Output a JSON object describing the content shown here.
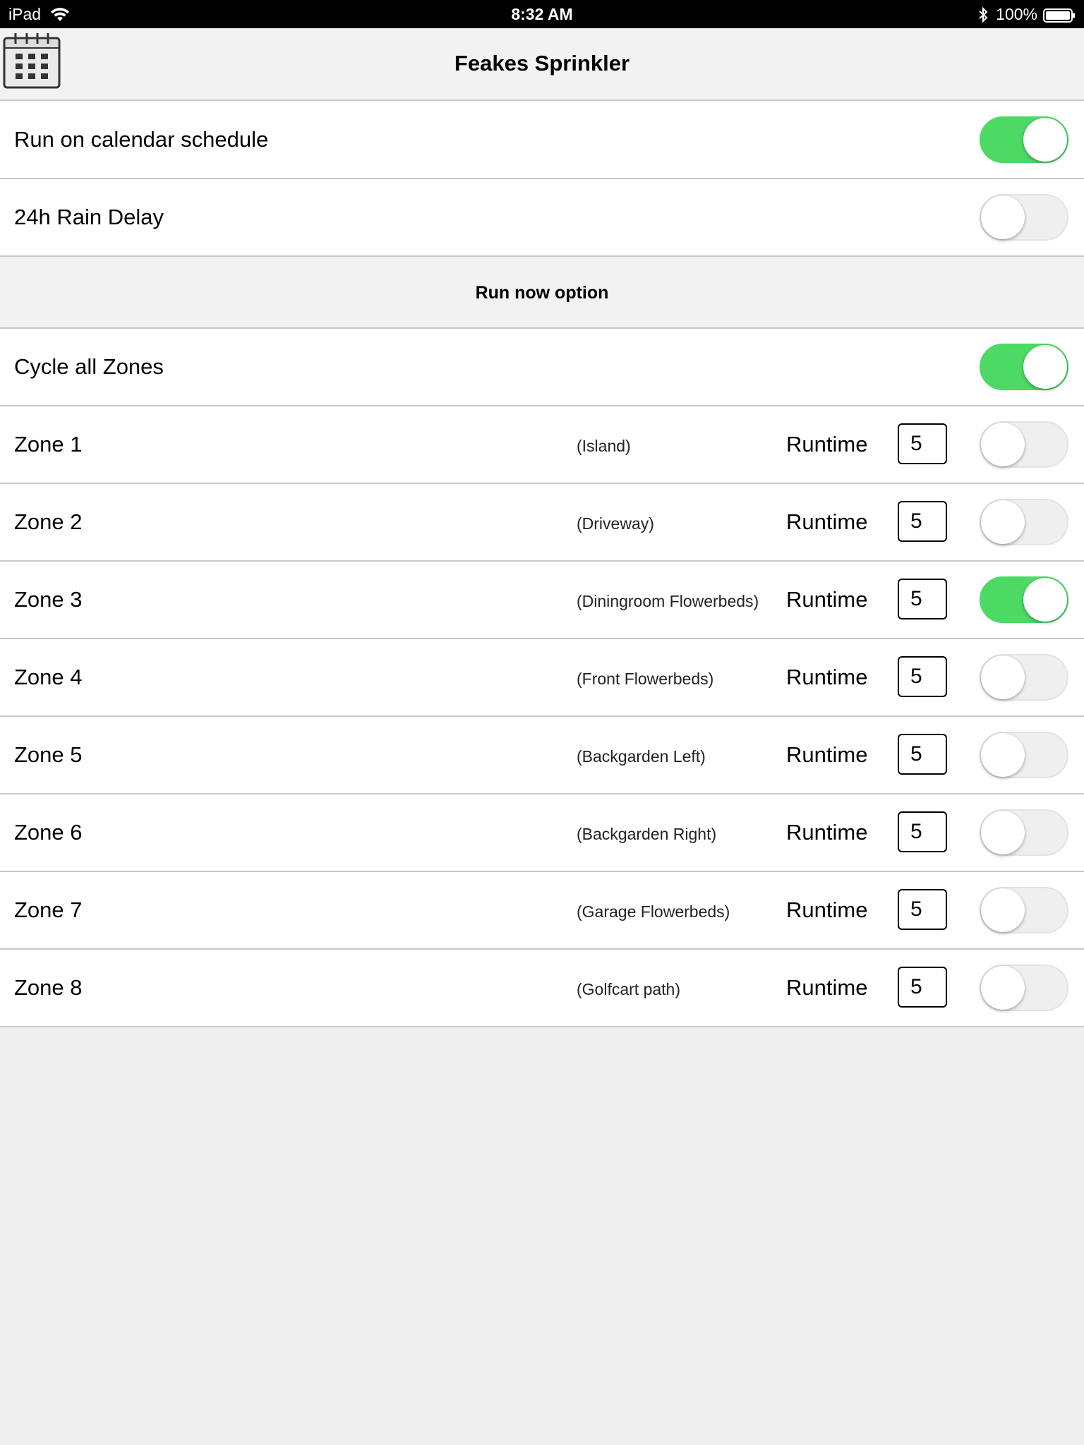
{
  "status_bar": {
    "device": "iPad",
    "time": "8:32 AM",
    "battery": "100%"
  },
  "header": {
    "title": "Feakes Sprinkler",
    "calendar_icon": "calendar-icon"
  },
  "settings": [
    {
      "label": "Run on calendar schedule",
      "on": true
    },
    {
      "label": "24h Rain Delay",
      "on": false
    }
  ],
  "section": {
    "title": "Run now option"
  },
  "cycle_all": {
    "label": "Cycle all Zones",
    "on": true
  },
  "zones": [
    {
      "name": "Zone 1",
      "location": "(Island)",
      "runtime_label": "Runtime",
      "runtime": "5",
      "on": false
    },
    {
      "name": "Zone 2",
      "location": "(Driveway)",
      "runtime_label": "Runtime",
      "runtime": "5",
      "on": false
    },
    {
      "name": "Zone 3",
      "location": "(Diningroom Flowerbeds)",
      "runtime_label": "Runtime",
      "runtime": "5",
      "on": true
    },
    {
      "name": "Zone 4",
      "location": "(Front Flowerbeds)",
      "runtime_label": "Runtime",
      "runtime": "5",
      "on": false
    },
    {
      "name": "Zone 5",
      "location": "(Backgarden Left)",
      "runtime_label": "Runtime",
      "runtime": "5",
      "on": false
    },
    {
      "name": "Zone 6",
      "location": "(Backgarden Right)",
      "runtime_label": "Runtime",
      "runtime": "5",
      "on": false
    },
    {
      "name": "Zone 7",
      "location": "(Garage Flowerbeds)",
      "runtime_label": "Runtime",
      "runtime": "5",
      "on": false
    },
    {
      "name": "Zone 8",
      "location": "(Golfcart path)",
      "runtime_label": "Runtime",
      "runtime": "5",
      "on": false
    }
  ],
  "colors": {
    "toggle_on": "#4cd964",
    "toggle_off": "#efeff0",
    "background": "#efeff0"
  }
}
